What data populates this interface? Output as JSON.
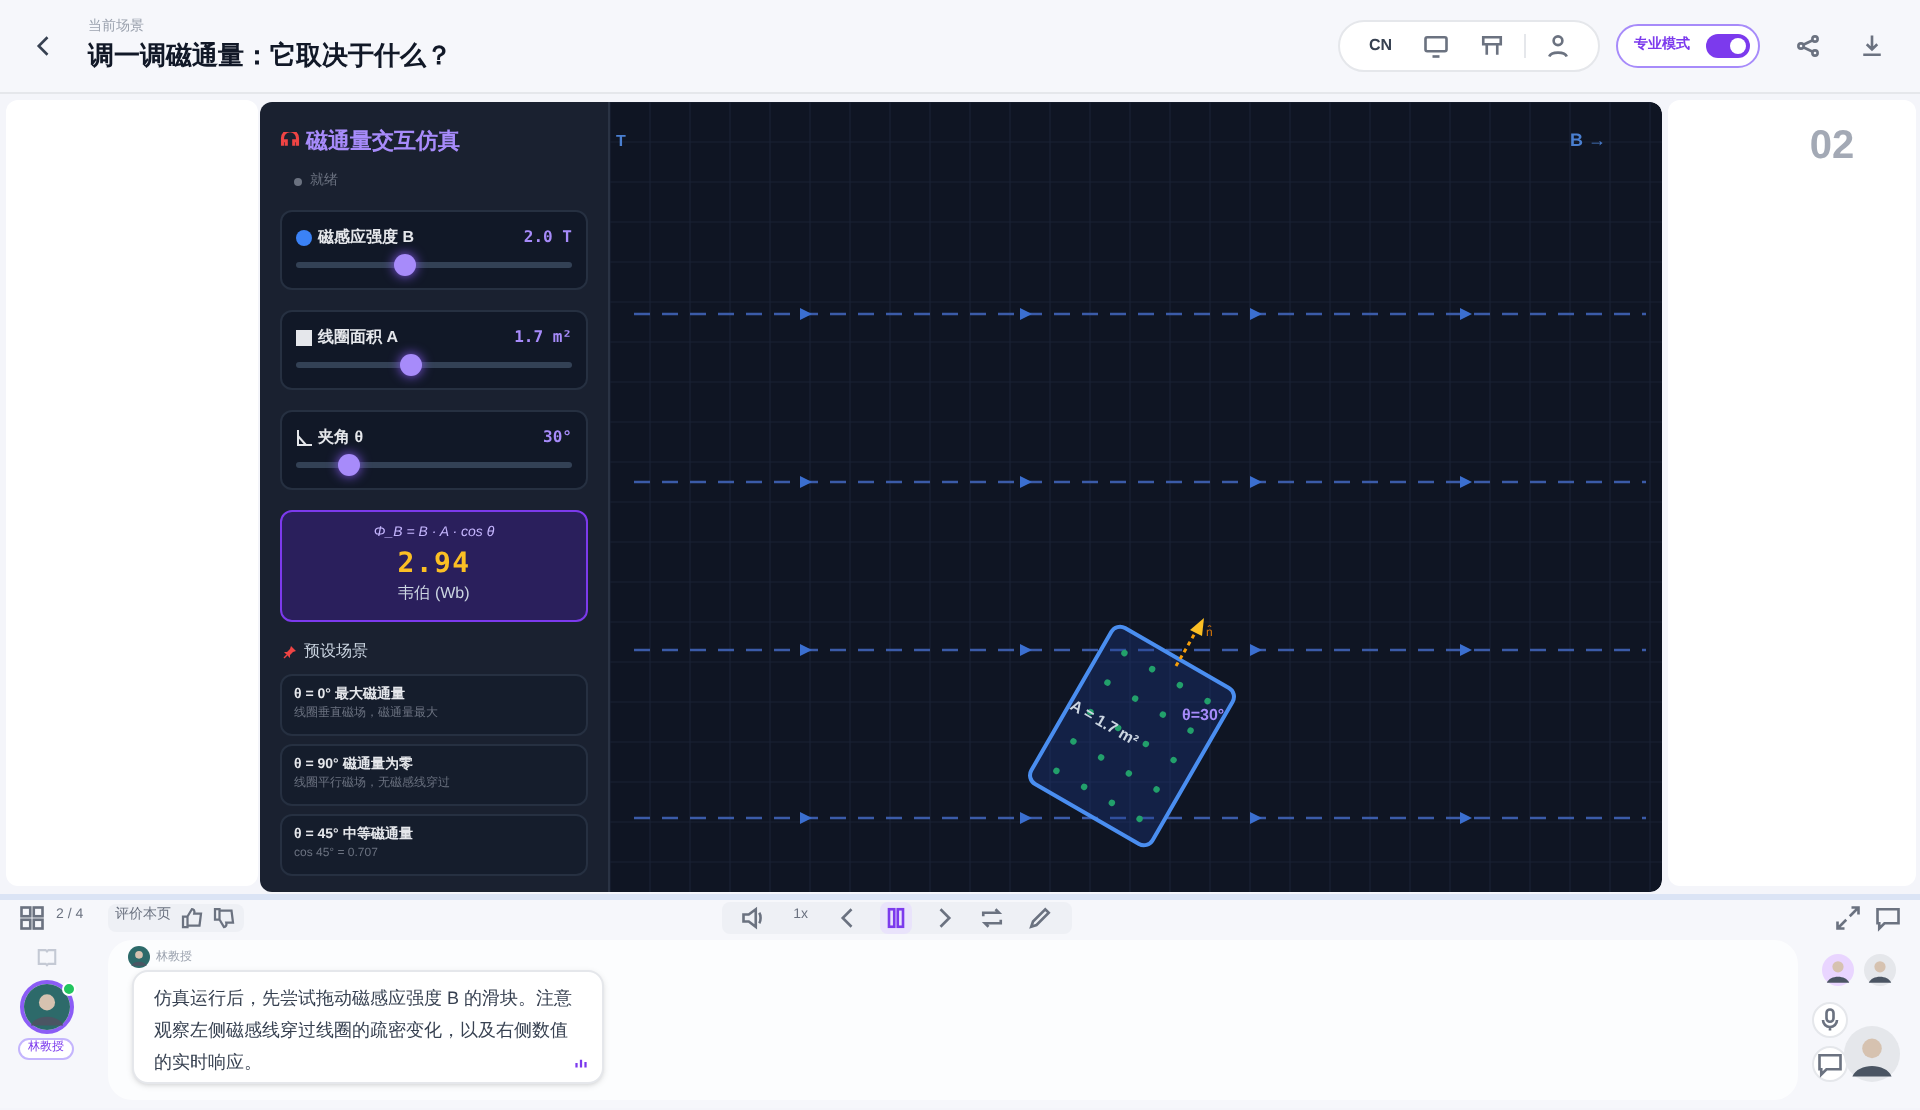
{
  "header": {
    "subtitle": "当前场景",
    "title": "调一调磁通量：它取决于什么？",
    "language": "CN",
    "pro_mode": {
      "label": "专业模式",
      "on": true
    }
  },
  "simulation": {
    "title": "磁通量交互仿真",
    "status": "就绪",
    "sliders": [
      {
        "label": "磁感应强度 B",
        "value": "2.0 T",
        "level": 0.39
      },
      {
        "label": "线圈面积 A",
        "value": "1.7 m²",
        "level": 0.41
      },
      {
        "label": "夹角 θ",
        "value": "30°",
        "level": 0.19
      }
    ],
    "result": {
      "formula": "Φ_B = B · A · cos θ",
      "value": "2.94",
      "unit": "韦伯 (Wb)"
    },
    "presets_title": "预设场景",
    "presets": [
      {
        "title": "θ = 0° 最大磁通量",
        "description": "线圈垂直磁场，磁通量最大"
      },
      {
        "title": "θ = 90° 磁通量为零",
        "description": "线圈平行磁场，无磁感线穿过"
      },
      {
        "title": "θ = 45° 中等磁通量",
        "description": "cos 45° = 0.707"
      }
    ],
    "canvas": {
      "corner_label": "T",
      "field_label": "B →",
      "coil_label": "A = 1.7 m²",
      "angle_label": "θ=30°",
      "normal_label": "n̂"
    }
  },
  "slide_number": "02",
  "toolbar": {
    "page": "2 / 4",
    "rate_label": "评价本页",
    "speed": "1x"
  },
  "chat": {
    "speaker": "林教授",
    "message": "仿真运行后，先尝试拖动磁感应强度 B 的滑块。注意观察左侧磁感线穿过线圈的疏密变化，以及右侧数值的实时响应。",
    "avatar_label": "林教授"
  }
}
